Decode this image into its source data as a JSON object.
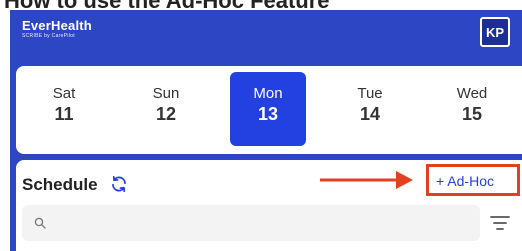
{
  "doc": {
    "heading": "How to use the Ad-Hoc Feature"
  },
  "header": {
    "logo_name": "EverHealth",
    "logo_sub": "SCRIBE by CarePilot",
    "avatar_initials": "KP",
    "color": "#2d47c4"
  },
  "date_strip": {
    "days": [
      {
        "dow": "Sat",
        "num": "11",
        "selected": false
      },
      {
        "dow": "Sun",
        "num": "12",
        "selected": false
      },
      {
        "dow": "Mon",
        "num": "13",
        "selected": true
      },
      {
        "dow": "Tue",
        "num": "14",
        "selected": false
      },
      {
        "dow": "Wed",
        "num": "15",
        "selected": false
      }
    ],
    "accent": "#2340e0"
  },
  "schedule": {
    "title": "Schedule",
    "refresh_icon": "refresh-icon",
    "adhoc_label": "+ Ad-Hoc",
    "search_placeholder": "",
    "filter_icon": "filter-icon"
  },
  "annotation": {
    "color": "#e2401f"
  }
}
